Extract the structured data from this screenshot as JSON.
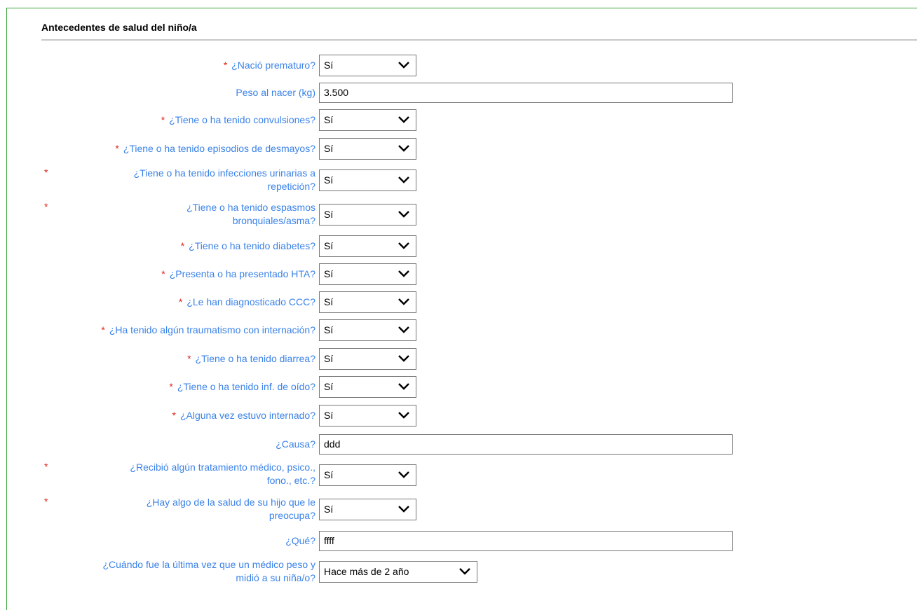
{
  "section": {
    "title": "Antecedentes de salud del niño/a"
  },
  "fields": {
    "premature": {
      "label": "¿Nació prematuro?",
      "value": "Sí"
    },
    "birth_weight": {
      "label": "Peso al nacer (kg)",
      "value": "3.500"
    },
    "seizures": {
      "label": "¿Tiene o ha tenido convulsiones?",
      "value": "Sí"
    },
    "fainting": {
      "label": "¿Tiene o ha tenido episodios de desmayos?",
      "value": "Sí"
    },
    "uti": {
      "label_line1": "¿Tiene o ha tenido infecciones urinarias a",
      "label_line2": "repetición?",
      "value": "Sí"
    },
    "bronchospasm": {
      "label_line1": "¿Tiene o ha tenido espasmos",
      "label_line2": "bronquiales/asma?",
      "value": "Sí"
    },
    "diabetes": {
      "label": "¿Tiene o ha tenido diabetes?",
      "value": "Sí"
    },
    "hta": {
      "label": "¿Presenta o ha presentado HTA?",
      "value": "Sí"
    },
    "ccc": {
      "label": "¿Le han diagnosticado CCC?",
      "value": "Sí"
    },
    "trauma": {
      "label": "¿Ha tenido algún traumatismo con internación?",
      "value": "Sí"
    },
    "diarrhea": {
      "label": "¿Tiene o ha tenido diarrea?",
      "value": "Sí"
    },
    "ear_infection": {
      "label": "¿Tiene o ha tenido inf. de oído?",
      "value": "Sí"
    },
    "hospitalized": {
      "label": "¿Alguna vez estuvo internado?",
      "value": "Sí"
    },
    "cause": {
      "label": "¿Causa?",
      "value": "ddd"
    },
    "treatment": {
      "label_line1": "¿Recibió algún tratamiento médico, psico.,",
      "label_line2": "fono., etc.?",
      "value": "Sí"
    },
    "concern": {
      "label_line1": "¿Hay algo de la salud de su hijo que le",
      "label_line2": "preocupa?",
      "value": "Sí"
    },
    "what": {
      "label": "¿Qué?",
      "value": "ffff"
    },
    "last_checkup": {
      "label_line1": "¿Cuándo fue la última vez que un médico peso y",
      "label_line2": "midió a su niña/o?",
      "value": "Hace más de 2 año"
    }
  },
  "required_marker": "*",
  "colors": {
    "label": "#3a82e8",
    "required": "#e0241b",
    "frame": "#3aa33a"
  },
  "icons": {
    "dropdown": "chevron-down-icon"
  }
}
